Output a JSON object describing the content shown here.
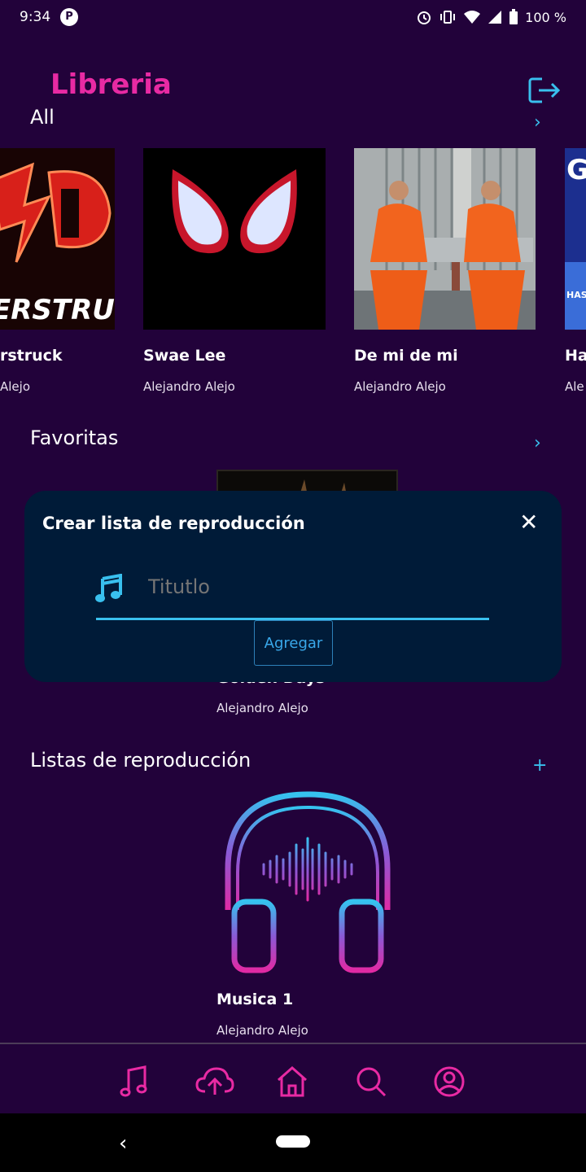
{
  "status": {
    "time": "9:34",
    "notif_icon": "p-icon",
    "battery": "100 %"
  },
  "header": {
    "title": "Libreria"
  },
  "all_section": {
    "title": "All",
    "items": [
      {
        "title": "rstruck",
        "artist": "Alejo"
      },
      {
        "title": "Swae Lee",
        "artist": "Alejandro Alejo"
      },
      {
        "title": "De mi de mi",
        "artist": "Alejandro Alejo"
      },
      {
        "title": "Ha",
        "artist": "Ale"
      }
    ]
  },
  "favorites": {
    "title": "Favoritas",
    "item": {
      "title": "Golden Days",
      "artist": "Alejandro Alejo"
    }
  },
  "playlists": {
    "title": "Listas de reproducción",
    "add": "+",
    "item": {
      "title": "Musica 1",
      "artist": "Alejandro Alejo"
    }
  },
  "modal": {
    "title": "Crear lista de reproducción",
    "close": "✕",
    "input_placeholder": "Titutlo",
    "button": "Agregar"
  },
  "colors": {
    "accent": "#e82aa3",
    "cyan": "#39c0ee",
    "bg": "#22023a",
    "modal": "#001b38"
  }
}
